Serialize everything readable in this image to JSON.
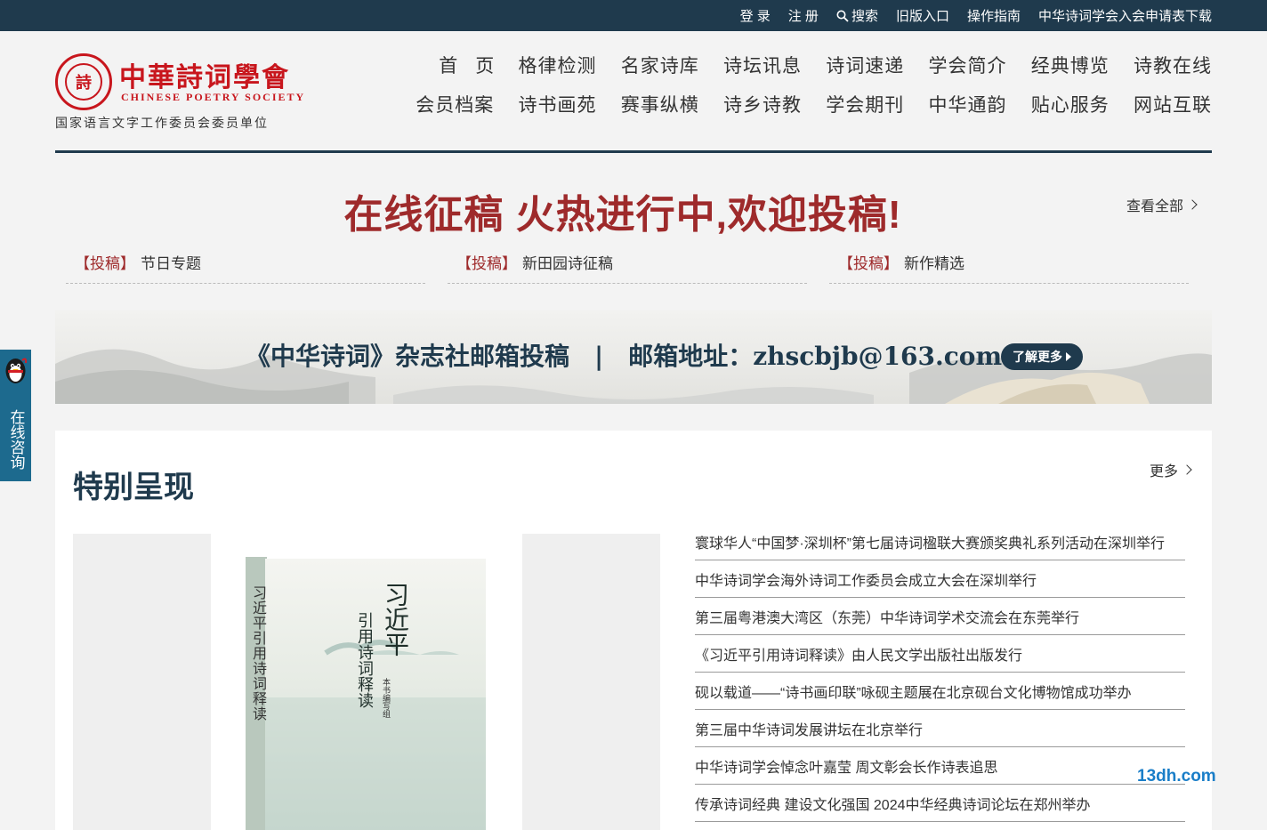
{
  "topbar": {
    "login": "登 录",
    "register": "注 册",
    "search": "搜索",
    "old_version": "旧版入口",
    "guide": "操作指南",
    "application": "中华诗词学会入会申请表下载"
  },
  "logo": {
    "seal_text": "詩",
    "cn_name": "中華詩词學會",
    "en_name": "CHINESE POETRY SOCIETY",
    "subtitle": "国家语言文字工作委员会委员单位"
  },
  "nav": {
    "items": [
      "首页",
      "格律检测",
      "名家诗库",
      "诗坛讯息",
      "诗词速递",
      "学会简介",
      "经典博览",
      "诗教在线",
      "会员档案",
      "诗书画苑",
      "赛事纵横",
      "诗乡诗教",
      "学会期刊",
      "中华通韵",
      "贴心服务",
      "网站互联"
    ]
  },
  "promo": {
    "title": "在线征稿 火热进行中,欢迎投稿!",
    "view_all": "查看全部",
    "links": [
      {
        "tag": "【投稿】",
        "label": "节日专题"
      },
      {
        "tag": "【投稿】",
        "label": "新田园诗征稿"
      },
      {
        "tag": "【投稿】",
        "label": "新作精选"
      }
    ]
  },
  "banner": {
    "text": "《中华诗词》杂志社邮箱投稿　|　邮箱地址：zhscbjb@163.com",
    "button": "了解更多"
  },
  "consult": {
    "label": "在线咨询"
  },
  "special": {
    "title": "特别呈现",
    "more": "更多",
    "book": {
      "spine_title": "习近平引用诗词释读",
      "cover_title_1": "习近平",
      "cover_title_2": "引用诗词释读",
      "publisher_small": "本书编写组"
    },
    "news": [
      "寰球华人“中国梦·深圳杯”第七届诗词楹联大赛颁奖典礼系列活动在深圳举行",
      "中华诗词学会海外诗词工作委员会成立大会在深圳举行",
      "第三届粤港澳大湾区（东莞）中华诗词学术交流会在东莞举行",
      "《习近平引用诗词释读》由人民文学出版社出版发行",
      "砚以载道——“诗书画印联”咏砚主题展在北京砚台文化博物馆成功举办",
      "第三届中华诗词发展讲坛在北京举行",
      "中华诗词学会悼念叶嘉莹 周文彰会长作诗表追思",
      "传承诗词经典 建设文化强国 2024中华经典诗词论坛在郑州举办"
    ]
  },
  "watermark": "13dh.com",
  "colors": {
    "navy": "#1f3a4d",
    "red": "#9e2a2b",
    "logo_red": "#c8161d",
    "consult_blue": "#1d6a8e"
  }
}
